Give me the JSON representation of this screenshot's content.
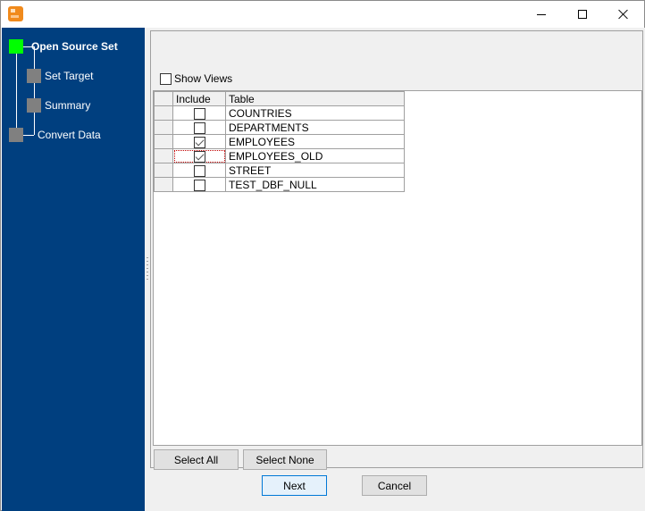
{
  "window": {
    "title": "",
    "icon": "app-icon",
    "controls": {
      "minimize": "minimize-icon",
      "maximize": "maximize-icon",
      "close": "close-icon"
    }
  },
  "sidebar": {
    "steps": [
      {
        "label": "Open Source Set",
        "active": true,
        "level": 0
      },
      {
        "label": "Set Target",
        "active": false,
        "level": 1
      },
      {
        "label": "Summary",
        "active": false,
        "level": 1
      },
      {
        "label": "Convert Data",
        "active": false,
        "level": 0
      }
    ]
  },
  "content": {
    "show_views": {
      "label": "Show Views",
      "checked": false
    },
    "grid": {
      "columns": [
        "Include",
        "Table"
      ],
      "rows": [
        {
          "include": false,
          "table": "COUNTRIES"
        },
        {
          "include": false,
          "table": "DEPARTMENTS"
        },
        {
          "include": true,
          "table": "EMPLOYEES"
        },
        {
          "include": true,
          "table": "EMPLOYEES_OLD",
          "focused": true
        },
        {
          "include": false,
          "table": "STREET"
        },
        {
          "include": false,
          "table": "TEST_DBF_NULL"
        }
      ]
    },
    "buttons": {
      "select_all": "Select All",
      "select_none": "Select None",
      "next": "Next",
      "cancel": "Cancel"
    }
  }
}
